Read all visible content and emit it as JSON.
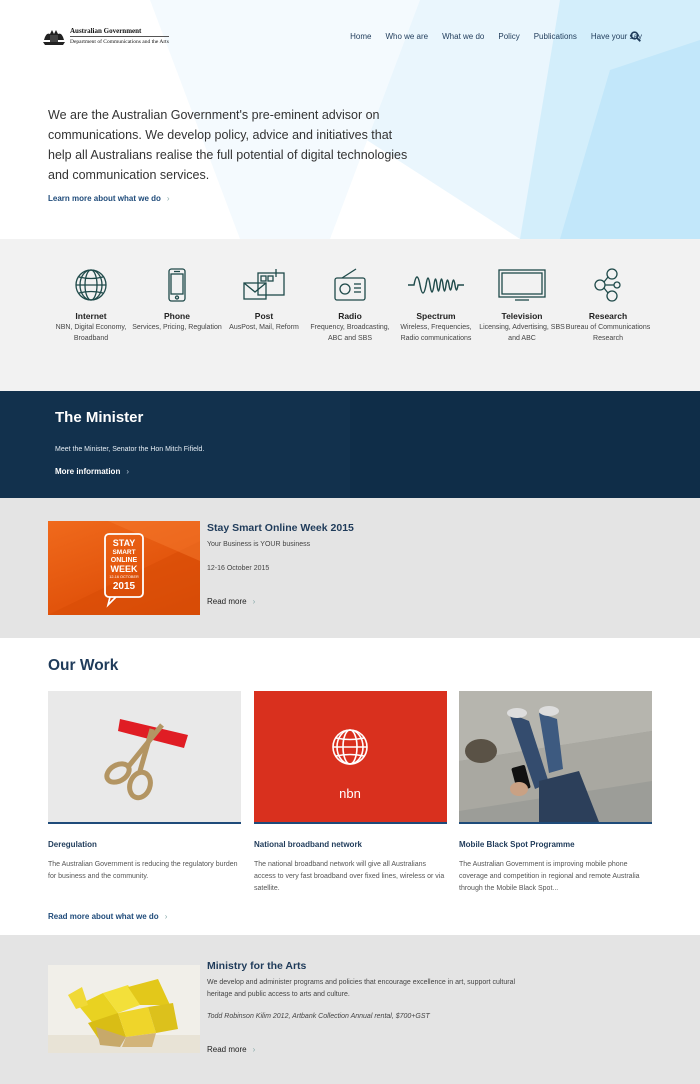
{
  "header": {
    "logo_line1": "Australian Government",
    "logo_line2": "Department of Communications and the Arts",
    "nav": [
      "Home",
      "Who we are",
      "What we do",
      "Policy",
      "Publications",
      "Have your say"
    ],
    "search_icon": "search-icon"
  },
  "hero": {
    "intro": "We are the Australian Government's pre-eminent advisor on communications. We develop policy, advice and initiatives that help all Australians realise the full potential of digital technologies and communication services.",
    "link": "Learn more about what we do"
  },
  "services": [
    {
      "title": "Internet",
      "desc": "NBN, Digital Economy, Broadband",
      "icon": "globe-icon"
    },
    {
      "title": "Phone",
      "desc": "Services, Pricing, Regulation",
      "icon": "phone-icon"
    },
    {
      "title": "Post",
      "desc": "AusPost, Mail, Reform",
      "icon": "mailbox-icon"
    },
    {
      "title": "Radio",
      "desc": "Frequency, Broadcasting, ABC and SBS",
      "icon": "radio-icon"
    },
    {
      "title": "Spectrum",
      "desc": "Wireless, Frequencies, Radio communications",
      "icon": "wave-icon"
    },
    {
      "title": "Television",
      "desc": "Licensing, Advertising, SBS and ABC",
      "icon": "tv-icon"
    },
    {
      "title": "Research",
      "desc": "Bureau of Communications Research",
      "icon": "molecule-icon"
    }
  ],
  "minister": {
    "title": "The Minister",
    "sub": "Meet the Minister, Senator the Hon Mitch Fifield.",
    "link": "More information"
  },
  "stay_smart": {
    "title": "Stay Smart Online Week 2015",
    "sub": "Your Business is YOUR business",
    "date": "12-16 October 2015",
    "link": "Read more",
    "badge_lines": [
      "STAY",
      "SMART",
      "ONLINE",
      "WEEK",
      "2015"
    ],
    "badge_dates": "12-16 OCTOBER"
  },
  "our_work": {
    "title": "Our Work",
    "cards": [
      {
        "title": "Deregulation",
        "desc": "The Australian Government is reducing the regulatory burden for business and the community."
      },
      {
        "title": "National broadband network",
        "desc": "The national broadband network will give all Australians access to very fast broadband over fixed lines, wireless or via satellite.",
        "logo_text": "nbn"
      },
      {
        "title": "Mobile Black Spot Programme",
        "desc": "The Australian Government is improving mobile phone coverage and competition in regional and remote Australia through the Mobile Black Spot..."
      }
    ],
    "link": "Read more about what we do"
  },
  "arts": {
    "title": "Ministry for the Arts",
    "desc": "We develop and administer programs and policies that encourage excellence in art, support cultural heritage and public access to arts and culture.",
    "caption": "Todd Robinson Kilim 2012, Artbank Collection Annual rental, $700+GST",
    "link": "Read more"
  },
  "colors": {
    "navy": "#12314d",
    "link": "#1f4b7a",
    "orange": "#e85b10",
    "nbn_red": "#d9301e",
    "icon_teal": "#1f4a4a"
  }
}
